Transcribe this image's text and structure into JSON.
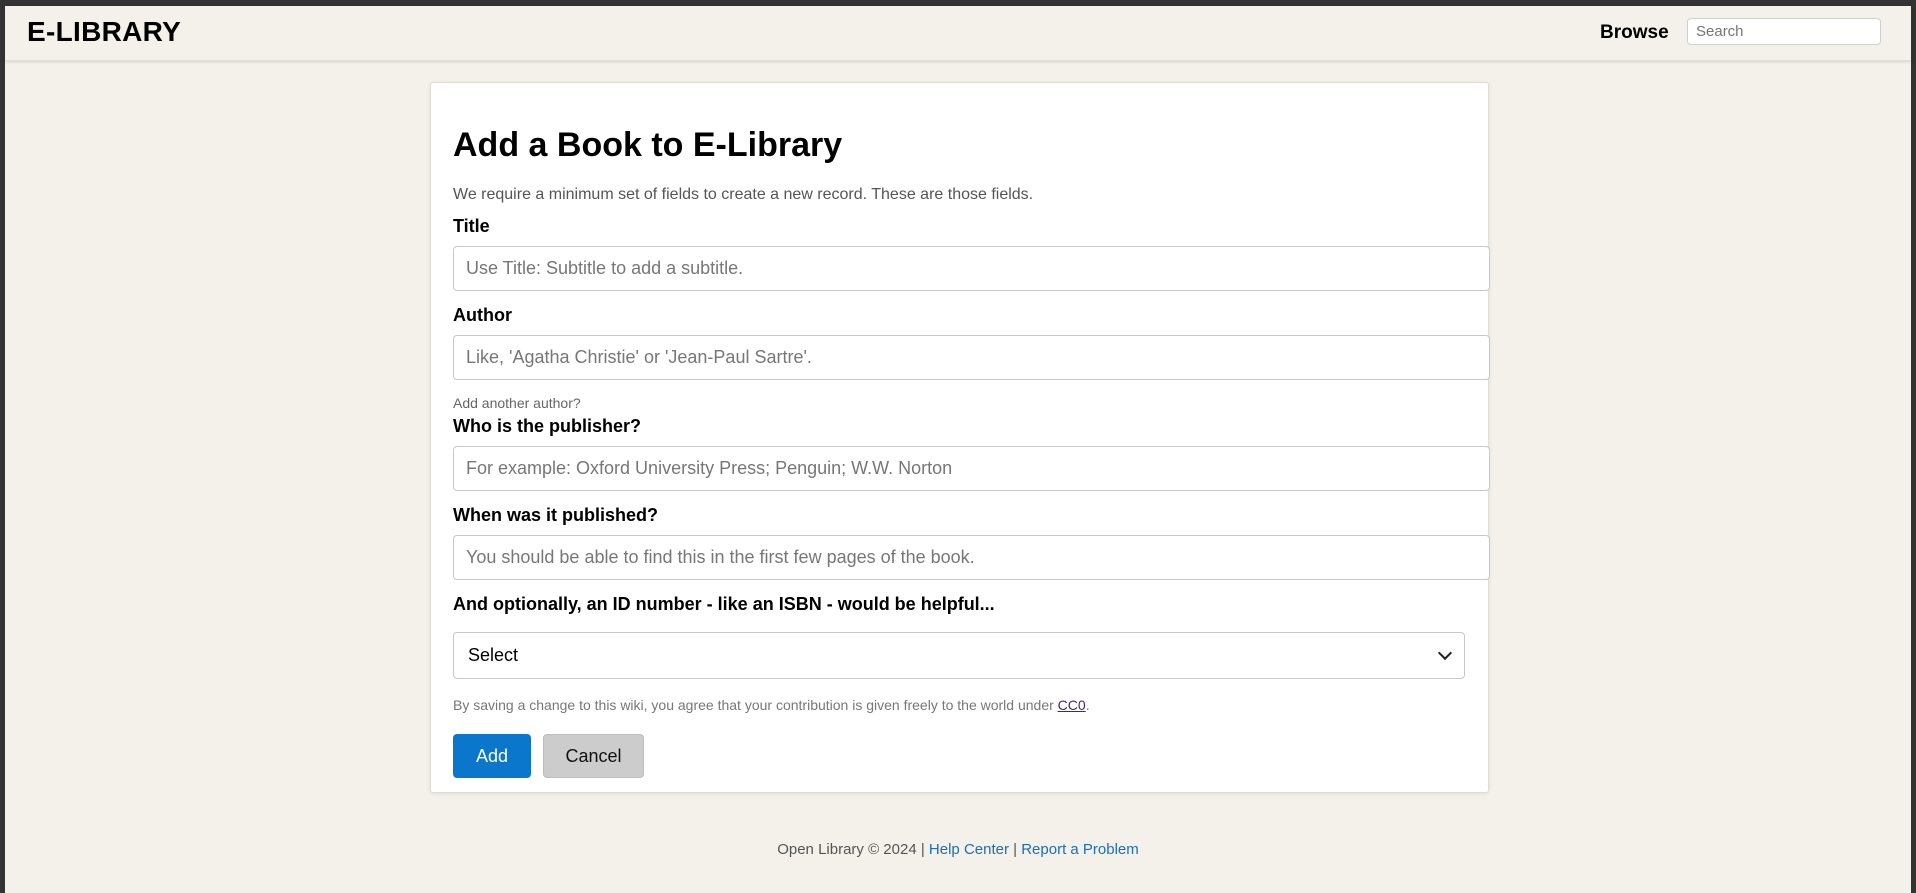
{
  "header": {
    "logo": "E-LIBRARY",
    "browse_label": "Browse",
    "search_placeholder": "Search"
  },
  "form": {
    "title": "Add a Book to E-Library",
    "intro": "We require a minimum set of fields to create a new record. These are those fields.",
    "fields": {
      "title": {
        "label": "Title",
        "placeholder": "Use Title: Subtitle to add a subtitle."
      },
      "author": {
        "label": "Author",
        "placeholder": "Like, 'Agatha Christie' or 'Jean-Paul Sartre'.",
        "add_another": "Add another author?"
      },
      "publisher": {
        "label": "Who is the publisher?",
        "placeholder": "For example: Oxford University Press; Penguin; W.W. Norton"
      },
      "published": {
        "label": "When was it published?",
        "placeholder": "You should be able to find this in the first few pages of the book."
      },
      "id_number": {
        "label": "And optionally, an ID number - like an ISBN - would be helpful...",
        "selected": "Select"
      }
    },
    "legal_text": "By saving a change to this wiki, you agree that your contribution is given freely to the world under ",
    "legal_link": "CC0",
    "legal_suffix": ".",
    "add_label": "Add",
    "cancel_label": "Cancel"
  },
  "footer": {
    "copyright": "Open Library © 2024",
    "separator": "|",
    "help_center": "Help Center",
    "report_problem": "Report a Problem"
  },
  "colors": {
    "page_background": "#f3f1ea",
    "primary_button": "#0a76cc",
    "secondary_button": "#cccccc",
    "footer_link": "#1a6ebd"
  }
}
